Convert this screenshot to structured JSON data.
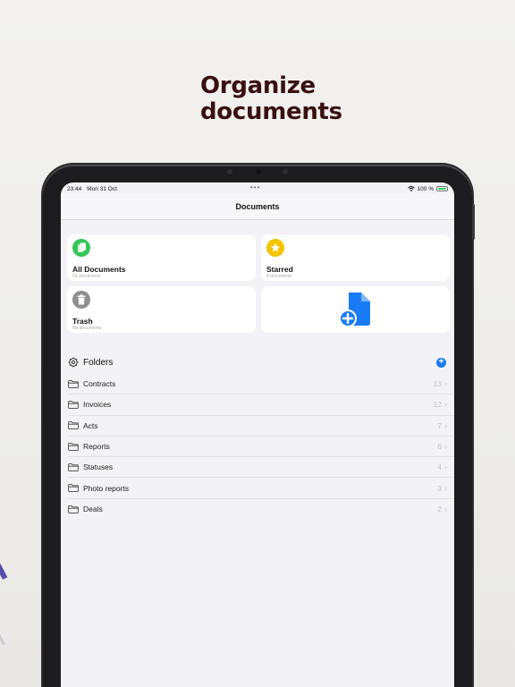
{
  "headline": [
    "Organize",
    "documents"
  ],
  "status_bar": {
    "time": "23:44",
    "date": "Mon 31 Oct",
    "battery": "100 %"
  },
  "navbar": {
    "title": "Documents"
  },
  "cards": [
    {
      "title": "All Documents",
      "subtitle": "53 documents",
      "icon": "documents-icon",
      "color": "#34c759"
    },
    {
      "title": "Starred",
      "subtitle": "4 documents",
      "icon": "star-icon",
      "color": "#f5c400"
    },
    {
      "title": "Trash",
      "subtitle": "No documents",
      "icon": "trash-icon",
      "color": "#8e8e93"
    }
  ],
  "add_card": {
    "icon": "new-document-icon",
    "color": "#1a7cf5"
  },
  "folders": {
    "label": "Folders",
    "items": [
      {
        "name": "Contracts",
        "count": "13"
      },
      {
        "name": "Invoices",
        "count": "12"
      },
      {
        "name": "Acts",
        "count": "7"
      },
      {
        "name": "Reports",
        "count": "6"
      },
      {
        "name": "Statuses",
        "count": "4"
      },
      {
        "name": "Photo reports",
        "count": "3"
      },
      {
        "name": "Deals",
        "count": "2"
      }
    ]
  }
}
